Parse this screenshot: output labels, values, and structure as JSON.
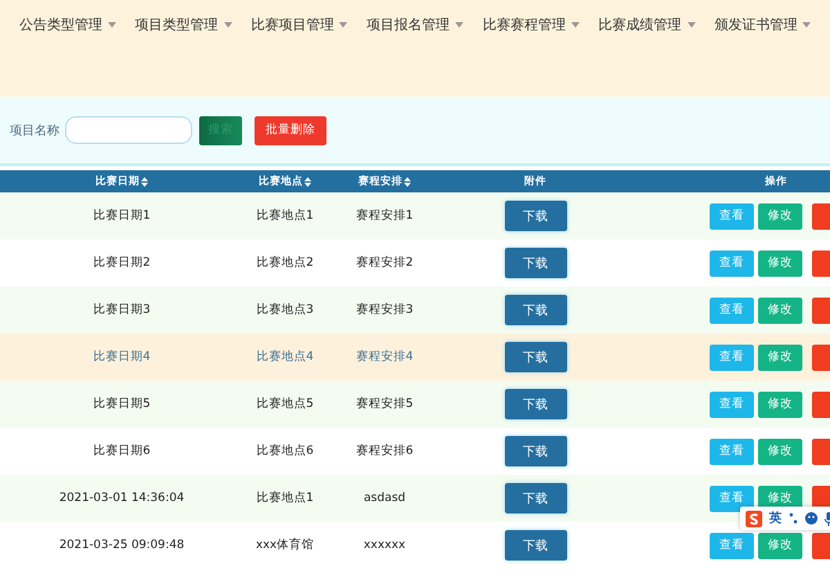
{
  "nav": {
    "items": [
      {
        "label": "公告类型管理"
      },
      {
        "label": "项目类型管理"
      },
      {
        "label": "比赛项目管理"
      },
      {
        "label": "项目报名管理"
      },
      {
        "label": "比赛赛程管理"
      },
      {
        "label": "比赛成绩管理"
      },
      {
        "label": "颁发证书管理"
      }
    ]
  },
  "search": {
    "label": "项目名称",
    "search_button": "搜索",
    "batch_delete_button": "批量删除"
  },
  "table": {
    "columns": [
      {
        "label": "比赛日期",
        "sortable": true
      },
      {
        "label": "比赛地点",
        "sortable": true
      },
      {
        "label": "赛程安排",
        "sortable": true
      },
      {
        "label": "附件",
        "sortable": false
      },
      {
        "label": "操作",
        "sortable": false
      }
    ],
    "rows": [
      {
        "date": "比赛日期1",
        "location": "比赛地点1",
        "schedule": "赛程安排1",
        "download": "下载",
        "view": "查看",
        "edit": "修改",
        "hovered": false
      },
      {
        "date": "比赛日期2",
        "location": "比赛地点2",
        "schedule": "赛程安排2",
        "download": "下载",
        "view": "查看",
        "edit": "修改",
        "hovered": false
      },
      {
        "date": "比赛日期3",
        "location": "比赛地点3",
        "schedule": "赛程安排3",
        "download": "下载",
        "view": "查看",
        "edit": "修改",
        "hovered": false
      },
      {
        "date": "比赛日期4",
        "location": "比赛地点4",
        "schedule": "赛程安排4",
        "download": "下载",
        "view": "查看",
        "edit": "修改",
        "hovered": true
      },
      {
        "date": "比赛日期5",
        "location": "比赛地点5",
        "schedule": "赛程安排5",
        "download": "下载",
        "view": "查看",
        "edit": "修改",
        "hovered": false
      },
      {
        "date": "比赛日期6",
        "location": "比赛地点6",
        "schedule": "赛程安排6",
        "download": "下载",
        "view": "查看",
        "edit": "修改",
        "hovered": false
      },
      {
        "date": "2021-03-01 14:36:04",
        "location": "比赛地点1",
        "schedule": "asdasd",
        "download": "下载",
        "view": "查看",
        "edit": "修改",
        "hovered": false
      },
      {
        "date": "2021-03-25 09:09:48",
        "location": "xxx体育馆",
        "schedule": "xxxxxx",
        "download": "下载",
        "view": "查看",
        "edit": "修改",
        "hovered": false
      }
    ]
  },
  "ime": {
    "label": "英"
  }
}
